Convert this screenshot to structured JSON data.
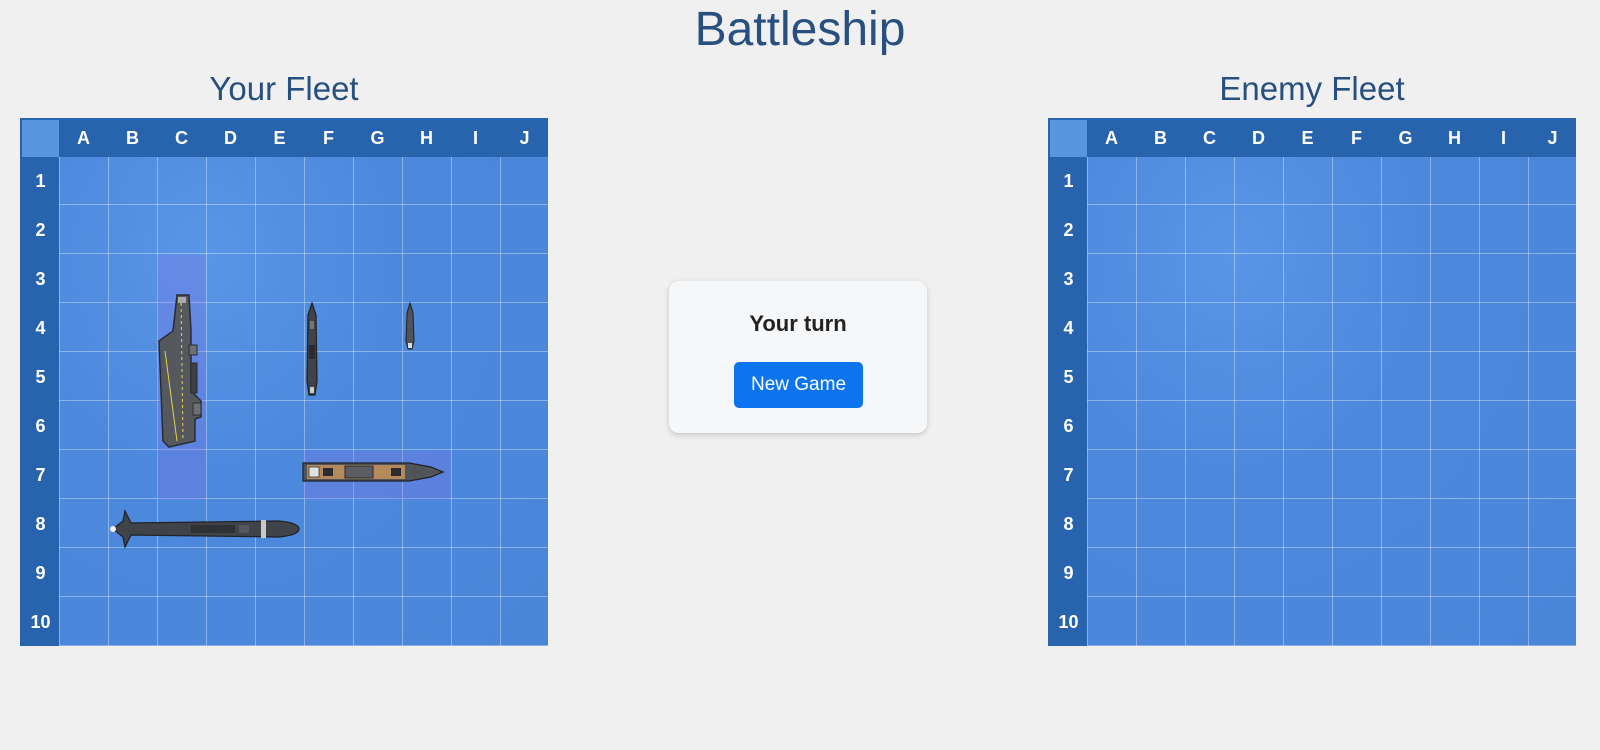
{
  "title": "Battleship",
  "player_board": {
    "title": "Your Fleet"
  },
  "enemy_board": {
    "title": "Enemy Fleet"
  },
  "columns": [
    "A",
    "B",
    "C",
    "D",
    "E",
    "F",
    "G",
    "H",
    "I",
    "J"
  ],
  "rows": [
    "1",
    "2",
    "3",
    "4",
    "5",
    "6",
    "7",
    "8",
    "9",
    "10"
  ],
  "status": {
    "text": "Your turn"
  },
  "actions": {
    "new_game_label": "New Game"
  },
  "fleet": [
    {
      "name": "carrier",
      "start": "C3",
      "orientation": "vertical",
      "length": 5
    },
    {
      "name": "battleship",
      "start": "F7",
      "orientation": "horizontal",
      "length": 3
    },
    {
      "name": "cruiser",
      "start": "E4",
      "orientation": "vertical",
      "length": 2
    },
    {
      "name": "destroyer",
      "start": "G4",
      "orientation": "vertical",
      "length": 1
    },
    {
      "name": "submarine",
      "start": "B9",
      "orientation": "horizontal",
      "length": 4
    }
  ],
  "colors": {
    "title": "#274f7f",
    "board_frame": "#2863ae",
    "water": "#4b88dc",
    "button": "#0d74f0"
  }
}
